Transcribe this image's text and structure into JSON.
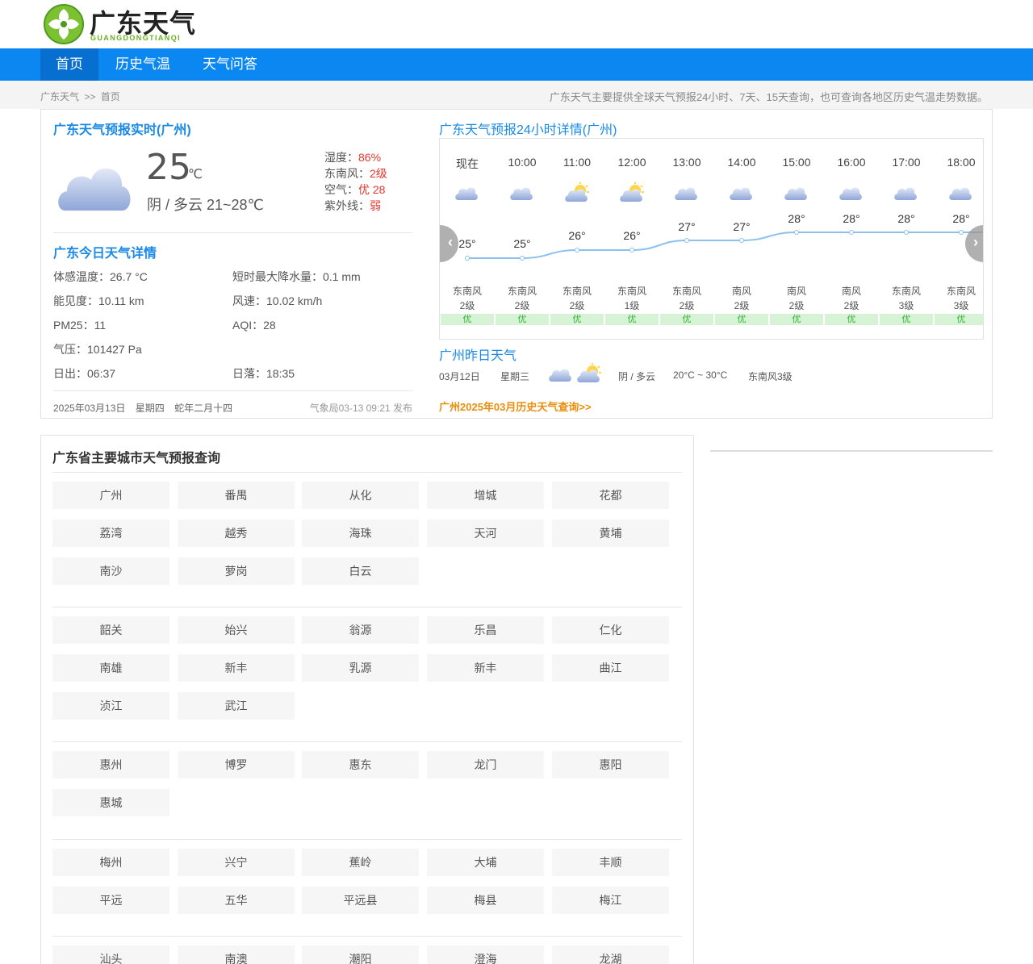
{
  "site": {
    "logo_text": "广东天气",
    "logo_sub": "GUANGDONGTIANQI",
    "nav": [
      "首页",
      "历史气温",
      "天气问答"
    ],
    "breadcrumb": {
      "home": "广东天气",
      "sep": ">>",
      "current": "首页"
    },
    "slogan": "广东天气主要提供全球天气预报24小时、7天、15天查询，也可查询各地区历史气温走势数据。"
  },
  "colors": {
    "brand_blue": "#0a87f0",
    "title_blue": "#1a8ae6",
    "alert_red": "#e8352e",
    "aqi_green": "#35b135",
    "link_orange": "#ea8e0e"
  },
  "current": {
    "title": "广东天气预报实时(广州)",
    "icon": "cloudy-icon",
    "temp": "25",
    "unit": "℃",
    "desc": "阴 / 多云 21~28℃",
    "humidity_label": "湿度：",
    "humidity": "86%",
    "wind_label": "东南风：",
    "wind": "2级",
    "air_label": "空气：",
    "air": "优 28",
    "uv_label": "紫外线：",
    "uv": "弱"
  },
  "today": {
    "title": "广东今日天气详情",
    "feel_label": "体感温度：",
    "feel": "26.7 °C",
    "rain_label": "短时最大降水量：",
    "rain": "0.1 mm",
    "vis_label": "能见度：",
    "vis": "10.11 km",
    "wspeed_label": "风速：",
    "wspeed": "10.02 km/h",
    "pm_label": "PM25：",
    "pm": "11",
    "aqi_label": "AQI：",
    "aqi": "28",
    "press_label": "气压：",
    "press": "101427 Pa",
    "sunrise_label": "日出：",
    "sunrise": "06:37",
    "sunset_label": "日落：",
    "sunset": "18:35"
  },
  "footer": {
    "date": "2025年03月13日",
    "weekday": "星期四",
    "lunar": "蛇年二月十四",
    "published": "气象局03-13 09:21 发布"
  },
  "hourly": {
    "title": "广东天气预报24小时详情(广州)",
    "items": [
      {
        "time": "现在",
        "temp": "25°",
        "t": 25,
        "icon": "cloudy-icon",
        "wind": "东南风",
        "level": "2级",
        "aqi": "优"
      },
      {
        "time": "10:00",
        "temp": "25°",
        "t": 25,
        "icon": "cloudy-icon",
        "wind": "东南风",
        "level": "2级",
        "aqi": "优"
      },
      {
        "time": "11:00",
        "temp": "26°",
        "t": 26,
        "icon": "partly-cloudy-icon",
        "wind": "东南风",
        "level": "2级",
        "aqi": "优"
      },
      {
        "time": "12:00",
        "temp": "26°",
        "t": 26,
        "icon": "partly-cloudy-icon",
        "wind": "东南风",
        "level": "1级",
        "aqi": "优"
      },
      {
        "time": "13:00",
        "temp": "27°",
        "t": 27,
        "icon": "cloudy-icon",
        "wind": "东南风",
        "level": "2级",
        "aqi": "优"
      },
      {
        "time": "14:00",
        "temp": "27°",
        "t": 27,
        "icon": "cloudy-icon",
        "wind": "南风",
        "level": "2级",
        "aqi": "优"
      },
      {
        "time": "15:00",
        "temp": "28°",
        "t": 28,
        "icon": "cloudy-icon",
        "wind": "南风",
        "level": "2级",
        "aqi": "优"
      },
      {
        "time": "16:00",
        "temp": "28°",
        "t": 28,
        "icon": "cloudy-icon",
        "wind": "南风",
        "level": "2级",
        "aqi": "优"
      },
      {
        "time": "17:00",
        "temp": "28°",
        "t": 28,
        "icon": "cloudy-icon",
        "wind": "东南风",
        "level": "3级",
        "aqi": "优"
      },
      {
        "time": "18:00",
        "temp": "28°",
        "t": 28,
        "icon": "cloudy-icon",
        "wind": "东南风",
        "level": "3级",
        "aqi": "优"
      }
    ]
  },
  "yesterday": {
    "title": "广州昨日天气",
    "date": "03月12日",
    "weekday": "星期三",
    "desc": "阴 / 多云",
    "temp": "20°C ~ 30°C",
    "wind": "东南风3级",
    "history_link": "广州2025年03月历史天气查询>>"
  },
  "cities": {
    "title": "广东省主要城市天气预报查询",
    "groups": [
      [
        "广州",
        "番禺",
        "从化",
        "增城",
        "花都",
        "荔湾",
        "越秀",
        "海珠",
        "天河",
        "黄埔",
        "南沙",
        "萝岗",
        "白云"
      ],
      [
        "韶关",
        "始兴",
        "翁源",
        "乐昌",
        "仁化",
        "南雄",
        "新丰",
        "乳源",
        "新丰",
        "曲江",
        "浈江",
        "武江"
      ],
      [
        "惠州",
        "博罗",
        "惠东",
        "龙门",
        "惠阳",
        "惠城"
      ],
      [
        "梅州",
        "兴宁",
        "蕉岭",
        "大埔",
        "丰顺",
        "平远",
        "五华",
        "平远县",
        "梅县",
        "梅江"
      ],
      [
        "汕头",
        "南澳",
        "潮阳",
        "澄海",
        "龙湖"
      ]
    ]
  }
}
